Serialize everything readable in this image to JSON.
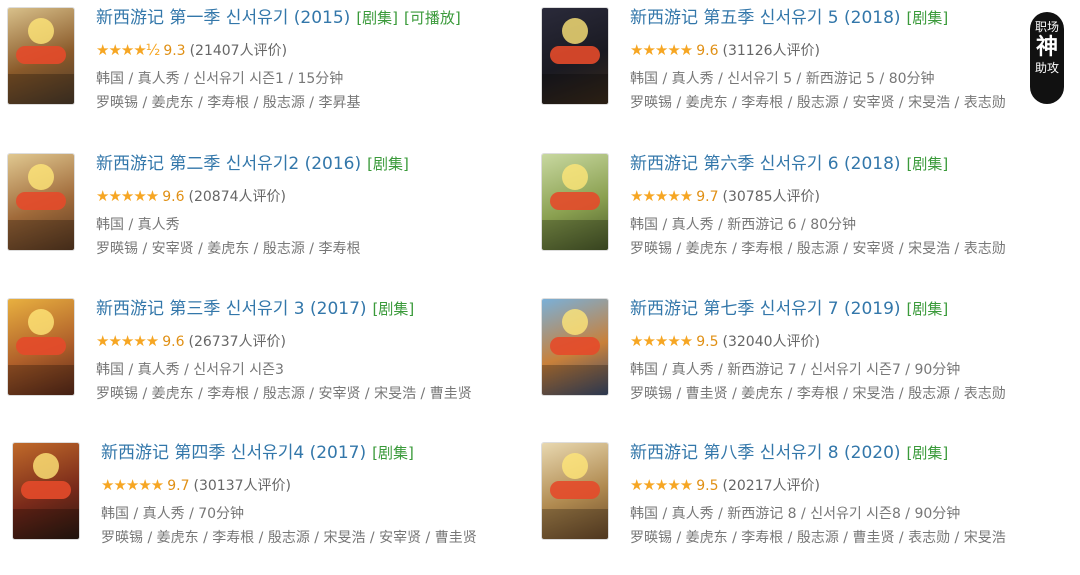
{
  "items": [
    {
      "title": "新西游记 第一季 신서유기 (2015)",
      "tags": [
        "[剧集]",
        "[可播放]"
      ],
      "score": "9.3",
      "votes": "(21407人评价)",
      "stars": "★★★★½",
      "meta": "韩国 / 真人秀 / 신서유기 시즌1 / 15分钟",
      "cast": "罗暎锡 / 姜虎东 / 李寿根 / 殷志源 / 李昇基"
    },
    {
      "title": "新西游记 第二季 신서유기2 (2016)",
      "tags": [
        "[剧集]"
      ],
      "score": "9.6",
      "votes": "(20874人评价)",
      "stars": "★★★★★",
      "meta": "韩国 / 真人秀",
      "cast": "罗暎锡 / 安宰贤 / 姜虎东 / 殷志源 / 李寿根"
    },
    {
      "title": "新西游记 第三季 신서유기 3 (2017)",
      "tags": [
        "[剧集]"
      ],
      "score": "9.6",
      "votes": "(26737人评价)",
      "stars": "★★★★★",
      "meta": "韩国 / 真人秀 / 신서유기 시즌3",
      "cast": "罗暎锡 / 姜虎东 / 李寿根 / 殷志源 / 安宰贤 / 宋旻浩 / 曹圭贤"
    },
    {
      "title": "新西游记 第四季 신서유기4 (2017)",
      "tags": [
        "[剧集]"
      ],
      "score": "9.7",
      "votes": "(30137人评价)",
      "stars": "★★★★★",
      "meta": "韩国 / 真人秀 / 70分钟",
      "cast": "罗暎锡 / 姜虎东 / 李寿根 / 殷志源 / 宋旻浩 / 安宰贤 / 曹圭贤"
    },
    {
      "title": "新西游记 第五季 신서유기 5 (2018)",
      "tags": [
        "[剧集]"
      ],
      "score": "9.6",
      "votes": "(31126人评价)",
      "stars": "★★★★★",
      "meta": "韩国 / 真人秀 / 신서유기 5 / 新西游记 5 / 80分钟",
      "cast": "罗暎锡 / 姜虎东 / 李寿根 / 殷志源 / 安宰贤 / 宋旻浩 / 表志勋"
    },
    {
      "title": "新西游记 第六季 신서유기 6 (2018)",
      "tags": [
        "[剧集]"
      ],
      "score": "9.7",
      "votes": "(30785人评价)",
      "stars": "★★★★★",
      "meta": "韩国 / 真人秀 / 新西游记 6 / 80分钟",
      "cast": "罗暎锡 / 姜虎东 / 李寿根 / 殷志源 / 安宰贤 / 宋旻浩 / 表志勋"
    },
    {
      "title": "新西游记 第七季 신서유기 7 (2019)",
      "tags": [
        "[剧集]"
      ],
      "score": "9.5",
      "votes": "(32040人评价)",
      "stars": "★★★★★",
      "meta": "韩国 / 真人秀 / 新西游记 7 / 신서유기 시즌7 / 90分钟",
      "cast": "罗暎锡 / 曹圭贤 / 姜虎东 / 李寿根 / 宋旻浩 / 殷志源 / 表志勋"
    },
    {
      "title": "新西游记 第八季 신서유기 8 (2020)",
      "tags": [
        "[剧集]"
      ],
      "score": "9.5",
      "votes": "(20217人评价)",
      "stars": "★★★★★",
      "meta": "韩国 / 真人秀 / 新西游记 8 / 신서유기 시즌8 / 90分钟",
      "cast": "罗暎锡 / 姜虎东 / 李寿根 / 殷志源 / 曹圭贤 / 表志勋 / 宋旻浩"
    }
  ],
  "watermark": {
    "line1": "职场",
    "line2": "神",
    "line3": "助攻"
  },
  "colors": {
    "title": "#3377aa",
    "tag": "#3a9a3a",
    "star": "#f6a623",
    "score": "#e09015"
  }
}
